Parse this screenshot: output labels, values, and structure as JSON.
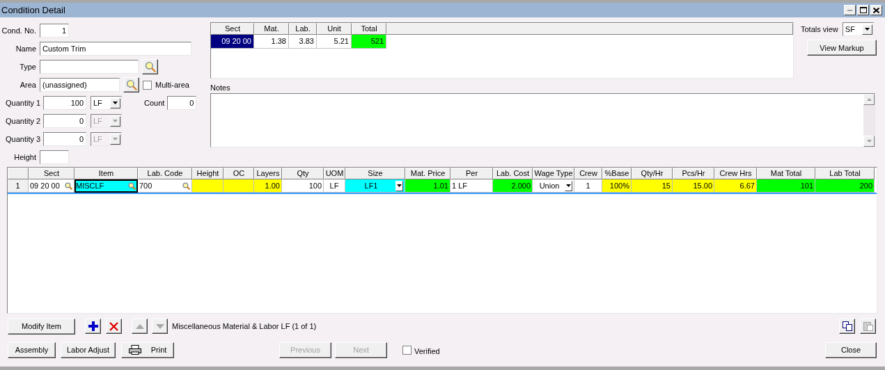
{
  "window": {
    "title": "Condition Detail"
  },
  "form": {
    "cond_no": {
      "label": "Cond. No.",
      "value": "1"
    },
    "name": {
      "label": "Name",
      "value": "Custom Trim"
    },
    "type": {
      "label": "Type"
    },
    "area": {
      "label": "Area",
      "value": "(unassigned)"
    },
    "multi_area": {
      "label": "Multi-area",
      "checked": false
    },
    "quantities": [
      {
        "label": "Quantity 1",
        "value": "100",
        "unit": "LF",
        "disabled": false
      },
      {
        "label": "Quantity 2",
        "value": "0",
        "unit": "LF",
        "disabled": true
      },
      {
        "label": "Quantity 3",
        "value": "0",
        "unit": "LF",
        "disabled": true
      }
    ],
    "count": {
      "label": "Count",
      "value": "0"
    },
    "height": {
      "label": "Height"
    }
  },
  "summary": {
    "columns": [
      "Sect",
      "Mat.",
      "Lab.",
      "Unit",
      "Total"
    ],
    "rows": [
      {
        "cells": [
          {
            "text": "09 20 00",
            "selected": true
          },
          {
            "text": "1.38",
            "selected": false
          },
          {
            "text": "3.83",
            "selected": false
          },
          {
            "text": "5.21",
            "selected": false
          },
          {
            "text": "521",
            "selected": false,
            "color": "#00ff00"
          }
        ]
      }
    ]
  },
  "notes": {
    "label": "Notes"
  },
  "totals_view": {
    "label": "Totals view",
    "value": "SF"
  },
  "view_markup": "View Markup",
  "grid": {
    "columns": [
      "Sect",
      "Item",
      "Lab. Code",
      "Height",
      "OC",
      "Layers",
      "Qty",
      "UOM",
      "Size",
      "Mat. Price",
      "Per",
      "Lab. Cost",
      "Wage Type",
      "Crew",
      "%Base",
      "Qty/Hr",
      "Pcs/Hr",
      "Crew Hrs",
      "Mat Total",
      "Lab Total"
    ],
    "rows": [
      {
        "number": "1",
        "cells": [
          {
            "kind": "lookup",
            "text": "09 20 00",
            "selected": false
          },
          {
            "kind": "lookup",
            "text": "MISCLF",
            "color": "#00ffff",
            "selected": true
          },
          {
            "kind": "lookup",
            "text": "700",
            "selected": false
          },
          {
            "kind": "number",
            "color": "#ffff00",
            "selected": false
          },
          {
            "kind": "number",
            "color": "#ffff00",
            "selected": false
          },
          {
            "kind": "number",
            "text": "1.00",
            "color": "#ffff00",
            "selected": false
          },
          {
            "kind": "number",
            "text": "100",
            "selected": false
          },
          {
            "kind": "center",
            "text": "LF",
            "selected": false
          },
          {
            "kind": "dropdown",
            "text": "LF1",
            "color": "#00ffff",
            "selected": false
          },
          {
            "kind": "number",
            "text": "1.01",
            "color": "#00ff00",
            "selected": false
          },
          {
            "kind": "text",
            "text": "1 LF",
            "selected": false
          },
          {
            "kind": "number",
            "text": "2.000",
            "color": "#00ff00",
            "selected": false
          },
          {
            "kind": "dropdown",
            "text": "Union",
            "selected": false
          },
          {
            "kind": "center",
            "text": "1",
            "selected": false
          },
          {
            "kind": "number",
            "text": "100%",
            "color": "#ffff00",
            "selected": false
          },
          {
            "kind": "number",
            "text": "15",
            "color": "#ffff00",
            "selected": false
          },
          {
            "kind": "number",
            "text": "15.00",
            "color": "#ffff00",
            "selected": false
          },
          {
            "kind": "number",
            "text": "6.67",
            "color": "#ffff00",
            "selected": false
          },
          {
            "kind": "number",
            "text": "101",
            "color": "#00ff00",
            "selected": false
          },
          {
            "kind": "number",
            "text": "200",
            "color": "#00ff00",
            "selected": false
          }
        ]
      }
    ]
  },
  "item_bar": {
    "modify": "Modify Item",
    "description": "Miscellaneous Material & Labor LF (1 of 1)",
    "tools": [
      {
        "kind": "add",
        "disabled": false
      },
      {
        "kind": "delete",
        "disabled": false
      },
      {
        "kind": "up",
        "disabled": true
      },
      {
        "kind": "down",
        "disabled": true
      }
    ],
    "clipboard": [
      {
        "kind": "copy",
        "disabled": false
      },
      {
        "kind": "paste",
        "disabled": true
      }
    ]
  },
  "buttons": [
    {
      "label": "Assembly",
      "disabled": false
    },
    {
      "label": "Labor Adjust",
      "disabled": false
    },
    {
      "label": "Print",
      "kind": "print",
      "disabled": false
    },
    {
      "label": "Previous",
      "disabled": true
    },
    {
      "label": "Next",
      "disabled": true
    }
  ],
  "verified": {
    "label": "Verified",
    "checked": false
  },
  "close": "Close"
}
